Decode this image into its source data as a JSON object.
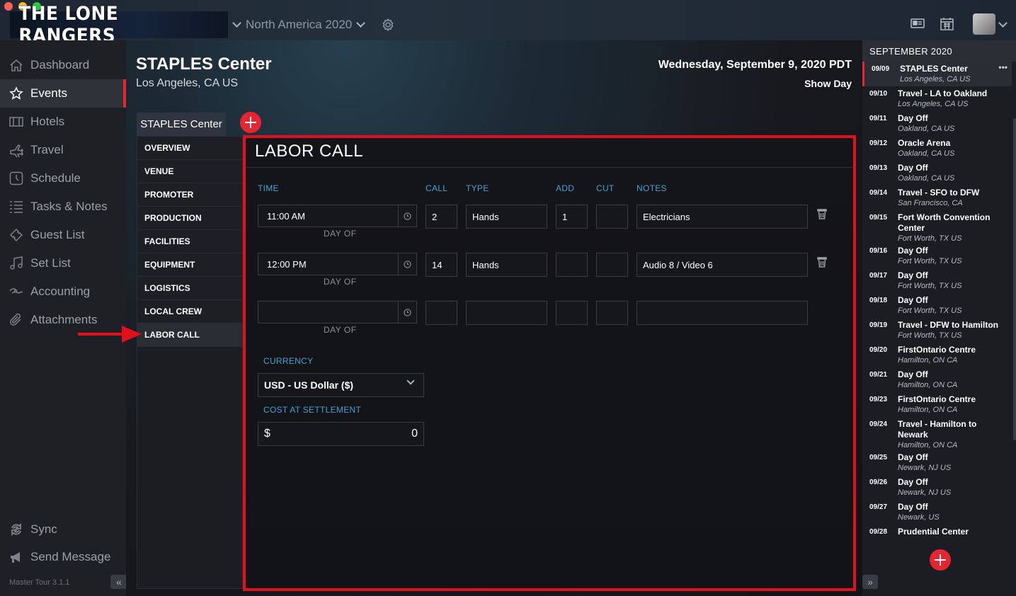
{
  "window": {
    "app_title": "THE LONE RANGERS",
    "tour_selector": "North America 2020"
  },
  "colors": {
    "accent": "#e52531",
    "link_blue": "#4aa0d2",
    "highlight_annotation": "#e0101d"
  },
  "sidebar": {
    "items": [
      {
        "label": "Dashboard",
        "icon": "home-icon"
      },
      {
        "label": "Events",
        "icon": "star-icon",
        "active": true
      },
      {
        "label": "Hotels",
        "icon": "hotel-icon"
      },
      {
        "label": "Travel",
        "icon": "plane-icon"
      },
      {
        "label": "Schedule",
        "icon": "clock-icon"
      },
      {
        "label": "Tasks & Notes",
        "icon": "list-icon"
      },
      {
        "label": "Guest List",
        "icon": "ticket-icon"
      },
      {
        "label": "Set List",
        "icon": "music-note-icon"
      },
      {
        "label": "Accounting",
        "icon": "money-icon"
      },
      {
        "label": "Attachments",
        "icon": "paperclip-icon"
      }
    ],
    "sync_label": "Sync",
    "send_message_label": "Send Message",
    "version": "Master Tour 3.1.1",
    "collapse_glyph": "«"
  },
  "event": {
    "title": "STAPLES Center",
    "location": "Los Angeles, CA US",
    "date": "Wednesday, September 9, 2020 PDT",
    "day_type": "Show Day",
    "venue_tab": "STAPLES Center"
  },
  "sections": {
    "items": [
      "OVERVIEW",
      "VENUE",
      "PROMOTER",
      "PRODUCTION",
      "FACILITIES",
      "EQUIPMENT",
      "LOGISTICS",
      "LOCAL CREW",
      "LABOR CALL"
    ],
    "active": "LABOR CALL"
  },
  "labor_call": {
    "title": "LABOR CALL",
    "columns": {
      "time": "TIME",
      "call": "CALL",
      "type": "TYPE",
      "add": "ADD",
      "cut": "CUT",
      "notes": "NOTES"
    },
    "rows": [
      {
        "time": "11:00 AM",
        "day_label": "DAY OF",
        "call": "2",
        "type": "Hands",
        "add": "1",
        "cut": "",
        "notes": "Electricians"
      },
      {
        "time": "12:00 PM",
        "day_label": "DAY OF",
        "call": "14",
        "type": "Hands",
        "add": "",
        "cut": "",
        "notes": "Audio 8 / Video 6"
      },
      {
        "time": "",
        "day_label": "DAY OF",
        "call": "",
        "type": "",
        "add": "",
        "cut": "",
        "notes": ""
      }
    ],
    "currency_label": "CURRENCY",
    "currency_value": "USD - US Dollar ($)",
    "cost_label": "COST AT SETTLEMENT",
    "cost_symbol": "$",
    "cost_value": "0"
  },
  "calendar": {
    "month": "SEPTEMBER 2020",
    "expand_glyph": "»",
    "days": [
      {
        "date": "09/09",
        "title": "STAPLES Center",
        "sub": "Los Angeles, CA US",
        "active": true
      },
      {
        "date": "09/10",
        "title": "Travel - LA to Oakland",
        "sub": "Los Angeles, CA US"
      },
      {
        "date": "09/11",
        "title": "Day Off",
        "sub": "Oakland, CA US"
      },
      {
        "date": "09/12",
        "title": "Oracle Arena",
        "sub": "Oakland, CA US"
      },
      {
        "date": "09/13",
        "title": "Day Off",
        "sub": "Oakland, CA US"
      },
      {
        "date": "09/14",
        "title": "Travel - SFO to DFW",
        "sub": "San Francisco, CA"
      },
      {
        "date": "09/15",
        "title": "Fort Worth Convention Center",
        "sub": "Fort Worth, TX US"
      },
      {
        "date": "09/16",
        "title": "Day Off",
        "sub": "Fort Worth, TX US"
      },
      {
        "date": "09/17",
        "title": "Day Off",
        "sub": "Fort Worth, TX US"
      },
      {
        "date": "09/18",
        "title": "Day Off",
        "sub": "Fort Worth, TX US"
      },
      {
        "date": "09/19",
        "title": "Travel - DFW to Hamilton",
        "sub": "Fort Worth, TX US"
      },
      {
        "date": "09/20",
        "title": "FirstOntario Centre",
        "sub": "Hamilton, ON CA"
      },
      {
        "date": "09/21",
        "title": "Day Off",
        "sub": "Hamilton, ON CA"
      },
      {
        "date": "09/23",
        "title": "FirstOntario Centre",
        "sub": "Hamilton, ON CA"
      },
      {
        "date": "09/24",
        "title": "Travel - Hamilton to Newark",
        "sub": "Hamilton, ON CA"
      },
      {
        "date": "09/25",
        "title": "Day Off",
        "sub": "Newark, NJ US"
      },
      {
        "date": "09/26",
        "title": "Day Off",
        "sub": "Newark, NJ US"
      },
      {
        "date": "09/27",
        "title": "Day Off",
        "sub": "Newark, US"
      },
      {
        "date": "09/28",
        "title": "Prudential Center",
        "sub": ""
      }
    ]
  }
}
